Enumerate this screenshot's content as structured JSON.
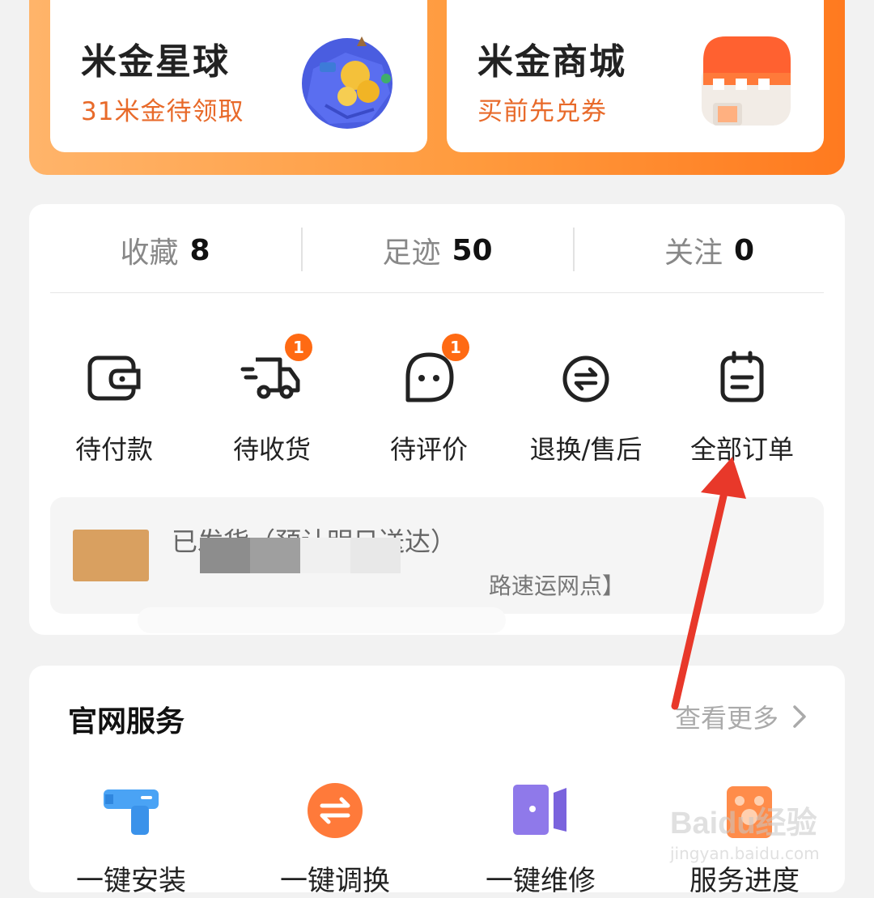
{
  "promo": [
    {
      "title": "米金星球",
      "subtitle": "31米金待领取",
      "icon": "planet-coins-icon"
    },
    {
      "title": "米金商城",
      "subtitle": "买前先兑券",
      "icon": "shop-store-icon"
    }
  ],
  "stats": [
    {
      "label": "收藏",
      "value": "8"
    },
    {
      "label": "足迹",
      "value": "50"
    },
    {
      "label": "关注",
      "value": "0"
    }
  ],
  "orders": [
    {
      "label": "待付款",
      "icon": "wallet-icon",
      "badge": ""
    },
    {
      "label": "待收货",
      "icon": "delivery-truck-icon",
      "badge": "1"
    },
    {
      "label": "待评价",
      "icon": "chat-bubble-icon",
      "badge": "1"
    },
    {
      "label": "退换/售后",
      "icon": "exchange-icon",
      "badge": ""
    },
    {
      "label": "全部订单",
      "icon": "order-list-icon",
      "badge": ""
    }
  ],
  "shipment": {
    "status": "已发货（预计明日送达）",
    "detail": "路速运网点】"
  },
  "services": {
    "title": "官网服务",
    "more": "查看更多",
    "items": [
      {
        "label": "一键安装",
        "icon": "drill-icon"
      },
      {
        "label": "一键调换",
        "icon": "swap-icon"
      },
      {
        "label": "一键维修",
        "icon": "door-repair-icon"
      },
      {
        "label": "服务进度",
        "icon": "service-progress-icon"
      }
    ]
  },
  "watermark": {
    "brand": "Baidu经验",
    "url": "jingyan.baidu.com"
  },
  "colors": {
    "accent": "#ff6a13",
    "banner_start": "#ffb46a",
    "banner_end": "#ff7a1f",
    "arrow": "#e8382a"
  }
}
